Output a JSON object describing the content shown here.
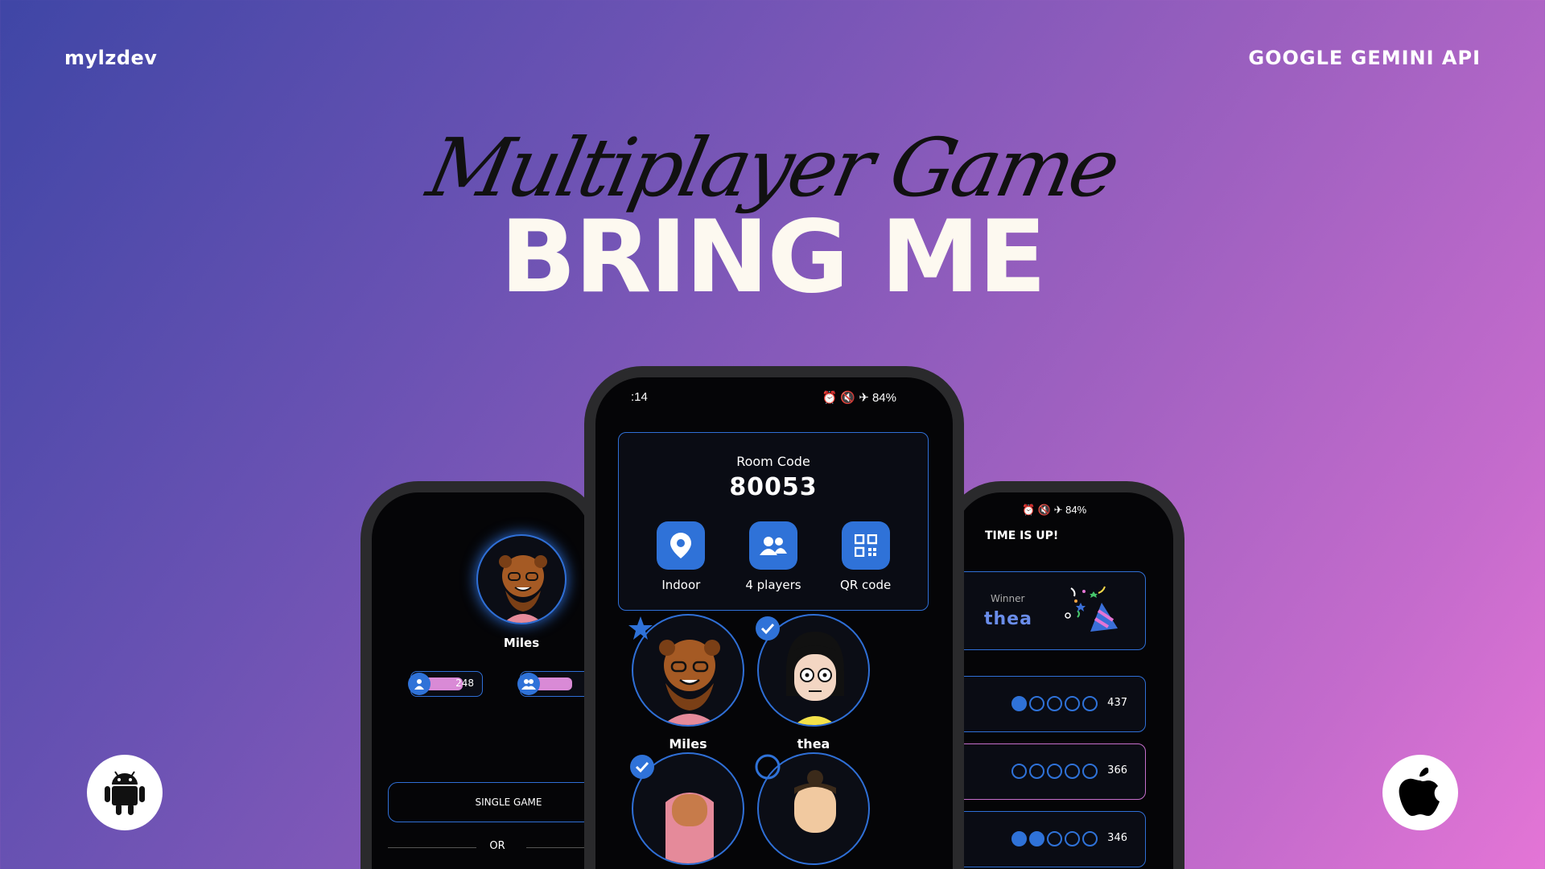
{
  "header": {
    "brand": "mylzdev",
    "api": "GOOGLE GEMINI API"
  },
  "hero": {
    "script_title": "Multiplayer Game",
    "title": "BRING ME"
  },
  "platforms": {
    "android": "android-icon",
    "apple": "apple-icon"
  },
  "center_phone": {
    "status_time": ":14",
    "status_battery": "84%",
    "room": {
      "label": "Room Code",
      "code": "80053",
      "options": [
        {
          "icon": "location-icon",
          "label": "Indoor"
        },
        {
          "icon": "group-icon",
          "label": "4 players"
        },
        {
          "icon": "qr-code-icon",
          "label": "QR code"
        }
      ]
    },
    "players": [
      {
        "name": "Miles",
        "badge": "star"
      },
      {
        "name": "thea",
        "badge": "check"
      },
      {
        "name": "",
        "badge": "check"
      },
      {
        "name": "",
        "badge": "empty"
      }
    ]
  },
  "left_phone": {
    "player_name": "Miles",
    "pill_score": "248",
    "single_game": "SINGLE GAME",
    "or": "OR"
  },
  "right_phone": {
    "status_battery": "84%",
    "times_up": "TIME IS UP!",
    "winner_label": "Winner",
    "winner_name": "thea",
    "scores": [
      {
        "filled": 1,
        "value": "437"
      },
      {
        "filled": 0,
        "value": "366"
      },
      {
        "filled": 2,
        "value": "346"
      }
    ]
  },
  "colors": {
    "accent": "#2f72d8",
    "pink": "#d98ad6",
    "winner": "#6a8dea"
  }
}
